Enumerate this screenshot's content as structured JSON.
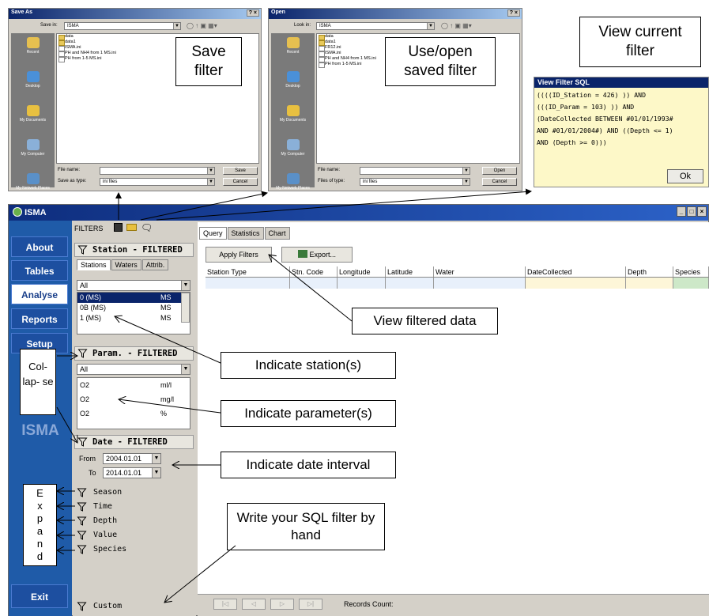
{
  "save_dialog": {
    "title": "Save As",
    "title_buttons": "? ×",
    "save_in_label": "Save in:",
    "save_in_value": "ISMA",
    "places": [
      "Recent",
      "Desktop",
      "My Documents",
      "My Computer",
      "My Network Places"
    ],
    "files": [
      "data",
      "data1",
      "ISMA.ini",
      "PH and NH4 from 1 MS.ini",
      "PH from 1-5 MS.ini"
    ],
    "file_name_label": "File name:",
    "save_as_type_label": "Save as type:",
    "save_as_type_value": "ini files",
    "save_button": "Save",
    "cancel_button": "Cancel"
  },
  "open_dialog": {
    "title": "Open",
    "title_buttons": "? ×",
    "look_in_label": "Look in:",
    "look_in_value": "ISMA",
    "places": [
      "Recent",
      "Desktop",
      "My Documents",
      "My Computer",
      "My Network Places"
    ],
    "files": [
      "data",
      "data1",
      "FR12.ini",
      "ISMA.ini",
      "PH and NH4 from 1 MS.ini",
      "PH from 1-5 MS.ini"
    ],
    "file_name_label": "File name:",
    "files_of_type_label": "Files of type:",
    "files_of_type_value": "ini files",
    "open_button": "Open",
    "cancel_button": "Cancel"
  },
  "callouts": {
    "save_filter": "Save filter",
    "open_filter": "Use/open saved filter",
    "view_current": "View current filter",
    "view_filtered": "View filtered data",
    "indicate_station": "Indicate station(s)",
    "indicate_parameter": "Indicate parameter(s)",
    "indicate_date": "Indicate date interval",
    "write_sql": "Write your SQL filter by hand",
    "collapse": "Col- lap- se",
    "expand": [
      "E",
      "x",
      "p",
      "a",
      "n",
      "d"
    ]
  },
  "sql_window": {
    "title": "View Filter SQL",
    "text": "((((ID_Station = 426) )) AND\n(((ID_Param = 103) )) AND\n(DateCollected BETWEEN #01/01/1993#\nAND #01/01/2004#) AND ((Depth <= 1)\nAND (Depth >= 0)))",
    "ok_button": "Ok"
  },
  "main_window": {
    "title": "ISMA",
    "title_buttons": [
      "_",
      "□",
      "×"
    ],
    "nav": [
      "About",
      "Tables",
      "Analyse",
      "Reports",
      "Setup"
    ],
    "active_nav": "Analyse",
    "brand": "ISMA",
    "exit": "Exit"
  },
  "filters": {
    "header": "FILTERS",
    "station_title": "Station - FILTERED",
    "station_tabs": [
      "Stations",
      "Waters",
      "Attrib."
    ],
    "station_combo": "All",
    "stations": [
      {
        "name": "0 (MS)",
        "type": "MS"
      },
      {
        "name": "0B (MS)",
        "type": "MS"
      },
      {
        "name": "1 (MS)",
        "type": "MS"
      }
    ],
    "param_title": "Param. - FILTERED",
    "param_combo": "All",
    "params": [
      {
        "name": "O2",
        "unit": "ml/l"
      },
      {
        "name": "O2",
        "unit": "mg/l"
      },
      {
        "name": "O2",
        "unit": "%"
      }
    ],
    "date_title": "Date - FILTERED",
    "from_label": "From",
    "from_value": "2004.01.01",
    "to_label": "To",
    "to_value": "2014.01.01",
    "extra": [
      "Season",
      "Time",
      "Depth",
      "Value",
      "Species"
    ],
    "custom": "Custom"
  },
  "right_pane": {
    "tabs": [
      "Query",
      "Statistics",
      "Chart"
    ],
    "active_tab": "Query",
    "apply_button": "Apply Filters",
    "export_button": "Export...",
    "columns": [
      "Station Type",
      "Stn. Code",
      "Longitude",
      "Latitude",
      "Water",
      "DateCollected",
      "Depth",
      "Species"
    ],
    "records_label": "Records Count:"
  }
}
